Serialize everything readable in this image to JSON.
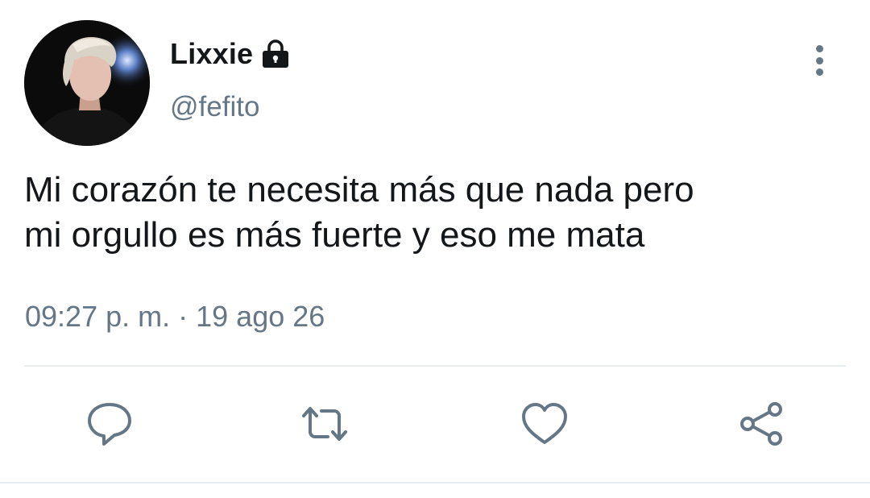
{
  "user": {
    "display_name": "Lixxie",
    "handle": "@fefito",
    "protected_icon": "lock-icon"
  },
  "tweet": {
    "text_lines": [
      "Mi corazón te necesita más que nada pero",
      "mi orgullo es más fuerte y eso me mata"
    ],
    "time": "09:27 p. m.",
    "separator": "·",
    "date": "19 ago 26"
  },
  "actions": {
    "icons": [
      "reply-icon",
      "retweet-icon",
      "like-icon",
      "share-icon"
    ]
  },
  "colors": {
    "text_primary": "#14171a",
    "text_secondary": "#657786",
    "divider": "#e6ecf0"
  }
}
